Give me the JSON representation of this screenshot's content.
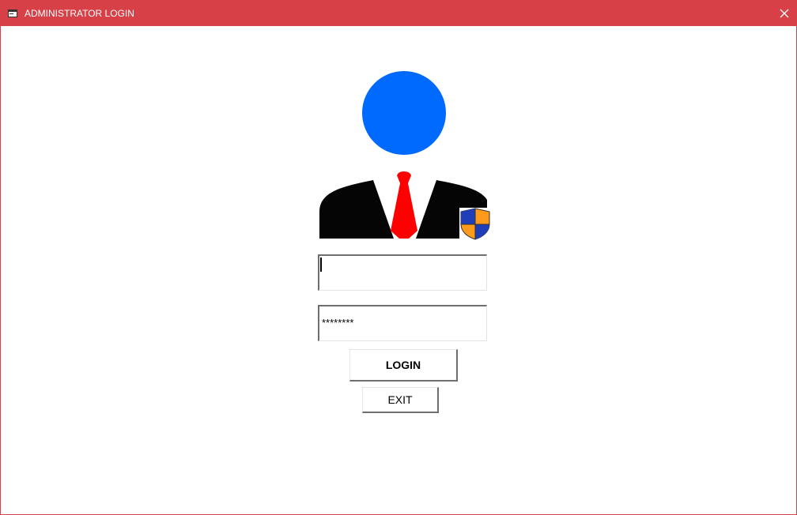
{
  "window": {
    "title": "ADMINISTRATOR LOGIN",
    "accent_color": "#d64046",
    "app_icon": "form-icon",
    "close_icon": "close-icon"
  },
  "avatar": {
    "icon": "administrator-avatar-icon",
    "badge_icon": "security-shield-icon",
    "head_color": "#006aff",
    "tie_color": "#ff0000"
  },
  "form": {
    "username": {
      "value": ""
    },
    "password": {
      "value": "********"
    },
    "login_label": "LOGIN",
    "exit_label": "EXIT"
  }
}
